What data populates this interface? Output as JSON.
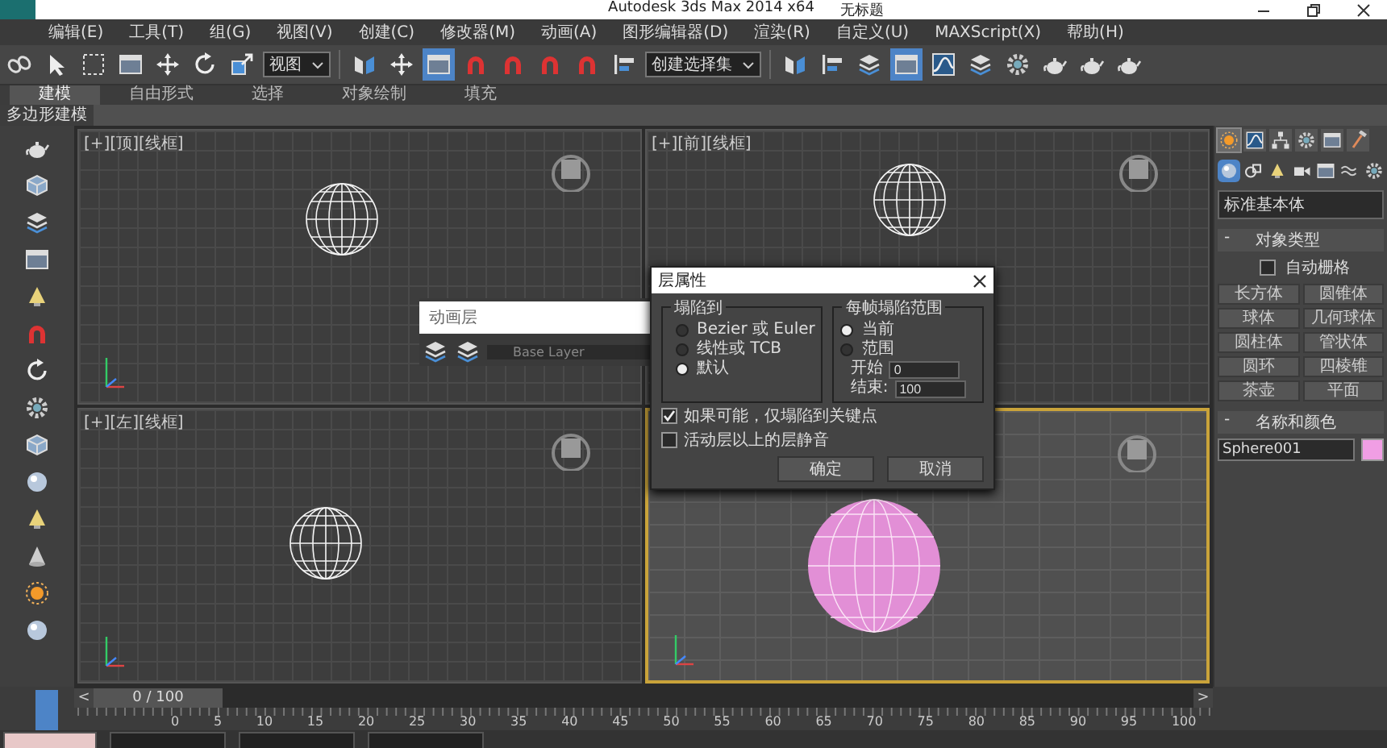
{
  "window": {
    "title": "Autodesk 3ds Max  2014 x64",
    "document": "无标题"
  },
  "menu": [
    "编辑(E)",
    "工具(T)",
    "组(G)",
    "视图(V)",
    "创建(C)",
    "修改器(M)",
    "动画(A)",
    "图形编辑器(D)",
    "渲染(R)",
    "自定义(U)",
    "MAXScript(X)",
    "帮助(H)"
  ],
  "toolbar": {
    "view_dropdown": "视图",
    "selection_set": "创建选择集",
    "tools_a": [
      {
        "kind": "link",
        "selected": false
      },
      {
        "kind": "cursor",
        "selected": false
      },
      {
        "kind": "rect",
        "selected": false
      },
      {
        "kind": "panel",
        "selected": false
      },
      {
        "kind": "move",
        "selected": false
      },
      {
        "kind": "rotate",
        "selected": false
      },
      {
        "kind": "scale",
        "selected": false
      }
    ],
    "tools_b": [
      {
        "kind": "mirror",
        "selected": false
      },
      {
        "kind": "move",
        "selected": false
      },
      {
        "kind": "panel",
        "selected": true
      },
      {
        "kind": "magnet",
        "selected": false
      },
      {
        "kind": "magnet",
        "selected": false
      },
      {
        "kind": "magnet",
        "selected": false
      },
      {
        "kind": "magnet",
        "selected": false
      },
      {
        "kind": "align",
        "selected": false
      }
    ],
    "tools_c": [
      {
        "kind": "mirror",
        "selected": false
      },
      {
        "kind": "align",
        "selected": false
      },
      {
        "kind": "layers",
        "selected": false
      },
      {
        "kind": "panel",
        "selected": true
      },
      {
        "kind": "curve",
        "selected": false
      },
      {
        "kind": "layers",
        "selected": false
      },
      {
        "kind": "gear",
        "selected": false
      },
      {
        "kind": "teapot",
        "selected": false
      },
      {
        "kind": "teapot",
        "selected": false
      },
      {
        "kind": "teapot",
        "selected": false
      }
    ]
  },
  "ribbon": {
    "tabs": [
      {
        "label": "建模",
        "selected": true
      },
      {
        "label": "自由形式",
        "selected": false
      },
      {
        "label": "选择",
        "selected": false
      },
      {
        "label": "对象绘制",
        "selected": false
      },
      {
        "label": "填充",
        "selected": false
      }
    ],
    "subtab": "多边形建模"
  },
  "left_tools": [
    {
      "kind": "teapot"
    },
    {
      "kind": "box"
    },
    {
      "kind": "layers"
    },
    {
      "kind": "panel"
    },
    {
      "kind": "light"
    },
    {
      "kind": "magnet"
    },
    {
      "kind": "rotate"
    },
    {
      "kind": "gear"
    },
    {
      "kind": "box"
    },
    {
      "kind": "sphere"
    },
    {
      "kind": "light"
    },
    {
      "kind": "cone"
    },
    {
      "kind": "sun"
    },
    {
      "kind": "sphere"
    }
  ],
  "viewports": [
    {
      "label": "[+][顶][线框]",
      "active": false,
      "kind": "wireframe"
    },
    {
      "label": "[+][前][线框]",
      "active": false,
      "kind": "wireframe"
    },
    {
      "label": "[+][左][线框]",
      "active": false,
      "kind": "wireframe"
    },
    {
      "active": true,
      "kind": "shaded"
    }
  ],
  "anim_layers": {
    "title": "动画层",
    "layer": "Base Layer"
  },
  "dialog": {
    "title": "层属性",
    "collapse_group": {
      "title": "塌陷到",
      "options": [
        {
          "label": "Bezier 或 Euler",
          "selected": false
        },
        {
          "label": "线性或 TCB",
          "selected": false
        },
        {
          "label": "默认",
          "selected": true
        }
      ]
    },
    "range_group": {
      "title": "每帧塌陷范围",
      "options": [
        {
          "label": "当前",
          "selected": true
        },
        {
          "label": "范围",
          "selected": false
        }
      ],
      "start_label": "开始",
      "start": "0",
      "end_label": "结束:",
      "end": "100"
    },
    "checks": [
      {
        "label": "如果可能，仅塌陷到关键点",
        "checked": true
      },
      {
        "label": "活动层以上的层静音",
        "checked": false
      }
    ],
    "buttons": [
      "确定",
      "取消"
    ]
  },
  "command_panel": {
    "tabs": [
      {
        "kind": "sun",
        "selected": true
      },
      {
        "kind": "curve",
        "selected": false
      },
      {
        "kind": "tree",
        "selected": false
      },
      {
        "kind": "gear",
        "selected": false
      },
      {
        "kind": "panel",
        "selected": false
      },
      {
        "kind": "hammer",
        "selected": false
      }
    ],
    "categories": [
      {
        "kind": "sphere",
        "selected": true
      },
      {
        "kind": "shapes",
        "selected": false
      },
      {
        "kind": "light",
        "selected": false
      },
      {
        "kind": "camera",
        "selected": false
      },
      {
        "kind": "panel",
        "selected": false
      },
      {
        "kind": "wave",
        "selected": false
      },
      {
        "kind": "gear",
        "selected": false
      }
    ],
    "dropdown": "标准基本体",
    "object_type": {
      "toggle": "-",
      "title": "对象类型",
      "autogrid": {
        "label": "自动栅格",
        "checked": false
      },
      "buttons": [
        "长方体",
        "圆锥体",
        "球体",
        "几何球体",
        "圆柱体",
        "管状体",
        "圆环",
        "四棱锥",
        "茶壶",
        "平面"
      ]
    },
    "name_color": {
      "toggle": "-",
      "title": "名称和颜色",
      "name": "Sphere001",
      "color": "#f09ee4"
    }
  },
  "timeline": {
    "prev": "<",
    "next": ">",
    "position": "0 / 100",
    "level": 0,
    "ticks": [
      "0",
      "5",
      "10",
      "15",
      "20",
      "25",
      "30",
      "35",
      "40",
      "45",
      "50",
      "55",
      "60",
      "65",
      "70",
      "75",
      "80",
      "85",
      "90",
      "95",
      "100"
    ]
  }
}
